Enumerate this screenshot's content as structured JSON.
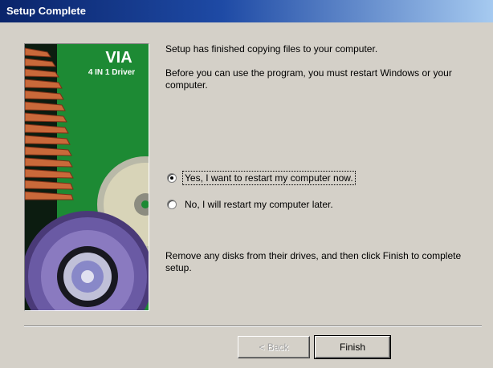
{
  "window": {
    "title": "Setup Complete"
  },
  "banner": {
    "brand": "VIA",
    "product": "4 IN 1 Driver"
  },
  "messages": {
    "finished": "Setup has finished copying files to your computer.",
    "restart_required": "Before you can use the program, you must restart Windows or your computer.",
    "remove_disks": "Remove any disks from their drives, and then click Finish to complete setup."
  },
  "options": [
    {
      "label": "Yes, I want to restart my computer now.",
      "selected": true
    },
    {
      "label": "No, I will restart my computer later.",
      "selected": false
    }
  ],
  "buttons": {
    "back": {
      "label": "< Back",
      "enabled": false
    },
    "finish": {
      "label": "Finish",
      "enabled": true
    }
  },
  "colors": {
    "titlebar_start": "#0a246a",
    "titlebar_end": "#a6caf0",
    "banner_green": "#1d8a34",
    "dialog_bg": "#d4d0c8"
  }
}
